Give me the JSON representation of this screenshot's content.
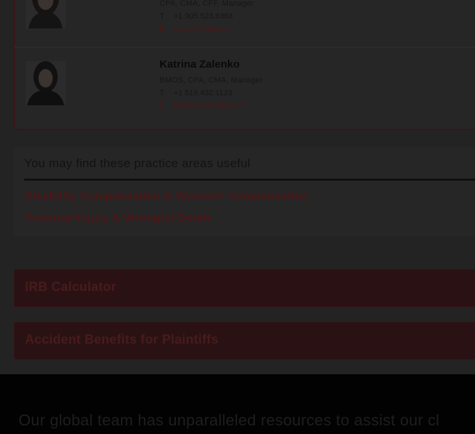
{
  "contacts": [
    {
      "name": "",
      "credentials": "CPA, CMA, CFF, Manager",
      "phone_label": "T",
      "phone": "+1 905.523.6363",
      "email_label": "E",
      "email": "apaci@mdd.com"
    },
    {
      "name": "Katrina Zalenko",
      "credentials": "BMOS, CPA, CMA, Manager",
      "phone_label": "T",
      "phone": "+1 519.432.1123",
      "email_label": "E",
      "email": "kzalenko@mdd.com"
    }
  ],
  "practice_areas": {
    "heading": "You may find these practice areas useful",
    "links": [
      "Disability Compensation & Workers' Compensation",
      "Personal Injury & Wrongful Death"
    ]
  },
  "ctas": [
    "IRB Calculator",
    "Accident Benefits for Plaintiffs"
  ],
  "footer": {
    "text": "Our global team has unparalleled resources to assist our cl"
  },
  "colors": {
    "overlay_background": "#232323",
    "accent_dim": "#4a1719",
    "footer_background": "#020202"
  }
}
